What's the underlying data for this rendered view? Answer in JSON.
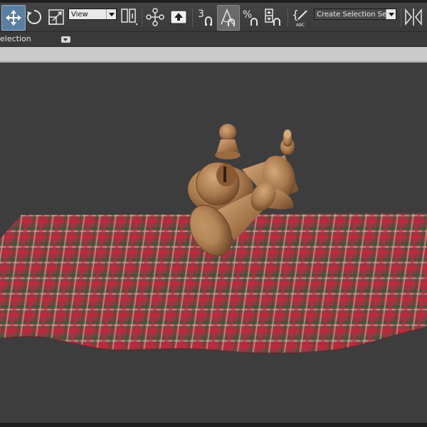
{
  "toolbar": {
    "items": [
      {
        "name": "select-and-move-icon",
        "active": true
      },
      {
        "name": "select-and-rotate-icon"
      },
      {
        "name": "select-and-scale-icon"
      },
      {
        "name": "use-pivot-point-icon"
      },
      {
        "name": "select-and-manipulate-icon"
      },
      {
        "name": "keyboard-shortcut-override-icon"
      },
      {
        "name": "snaps-toggle-icon"
      },
      {
        "name": "angle-snap-toggle-icon"
      },
      {
        "name": "percent-snap-toggle-icon"
      },
      {
        "name": "spinner-snap-toggle-icon"
      },
      {
        "name": "edit-named-selection-sets-icon"
      },
      {
        "name": "mirror-icon"
      }
    ],
    "reference_coord": {
      "value": "View"
    },
    "snap_label": "3",
    "selection_set": {
      "placeholder": "Create Selection Se"
    },
    "colors": {
      "active_bg": "#5a7fa0",
      "icon": "#e6e6e6"
    }
  },
  "ribbon": {
    "label": "election"
  },
  "scene": {
    "colors": {
      "viewport_bg": "#3d3d3d",
      "cloth_base": "#8a3d45",
      "cloth_red": "#c2283c",
      "cloth_green": "#2f5a3a",
      "cloth_light": "#c9b59c",
      "wood": "#a8784d",
      "wood_light": "#d4a77a",
      "wood_dark": "#6b4526"
    }
  }
}
